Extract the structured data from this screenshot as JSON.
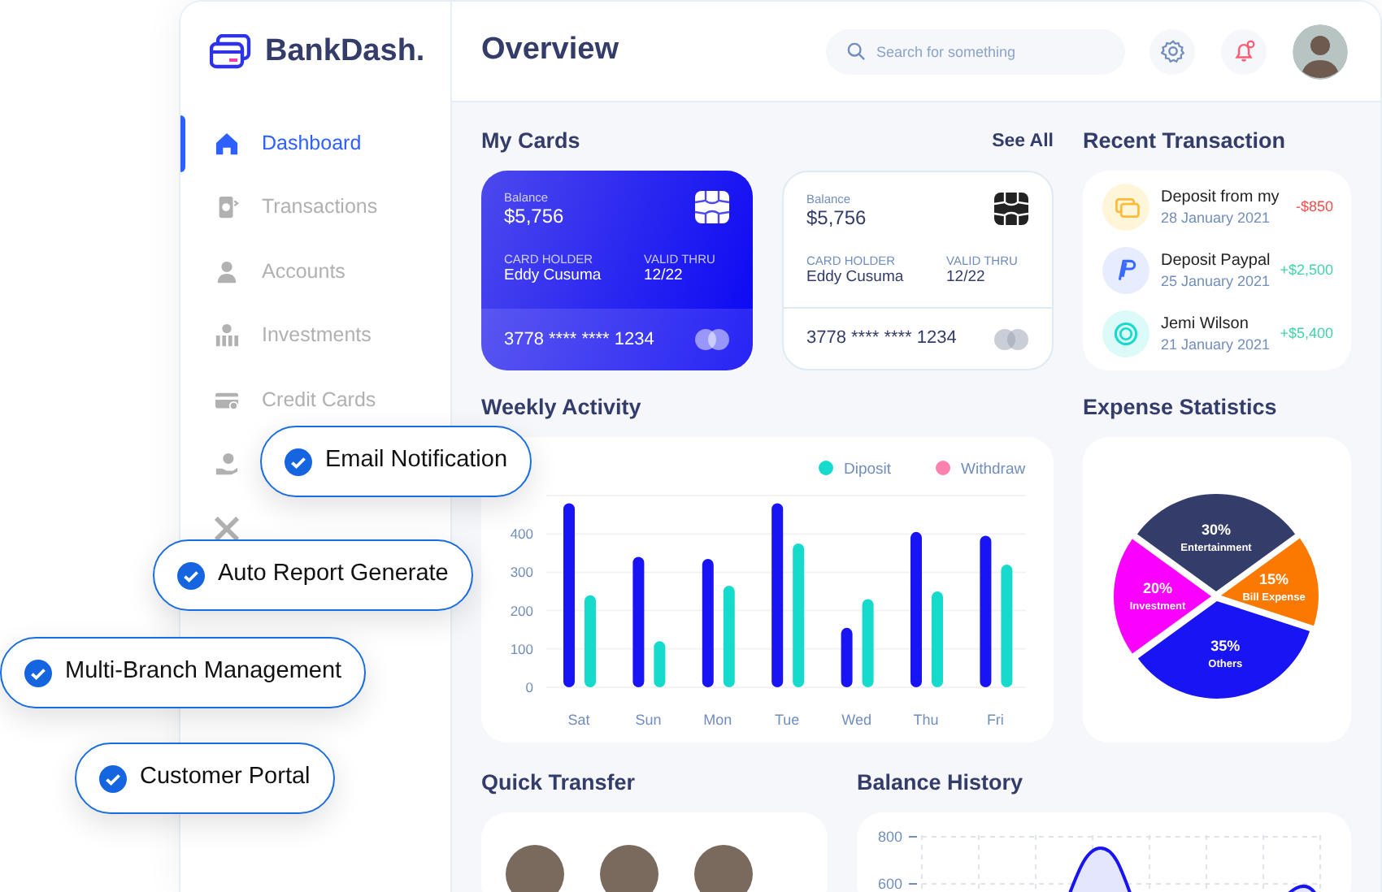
{
  "sidebar": {
    "logo": "BankDash.",
    "items": [
      {
        "label": "Dashboard",
        "selected": true
      },
      {
        "label": "Transactions",
        "selected": false
      },
      {
        "label": "Accounts",
        "selected": false
      },
      {
        "label": "Investments",
        "selected": false
      },
      {
        "label": "Credit Cards",
        "selected": false
      },
      {
        "selected": false
      },
      {
        "selected": false
      }
    ]
  },
  "header": {
    "title": "Overview",
    "search": {
      "placeholder": "Search for something"
    }
  },
  "my_cards": {
    "title": "My Cards",
    "link": "See All",
    "cards": [
      {
        "kind": "dark",
        "balance_label": "Balance",
        "balance": "$5,756",
        "holder_label": "CARD HOLDER",
        "holder": "Eddy Cusuma",
        "valid_label": "VALID THRU",
        "valid": "12/22",
        "number": "3778 **** **** 1234"
      },
      {
        "kind": "light",
        "balance_label": "Balance",
        "balance": "$5,756",
        "holder_label": "CARD HOLDER",
        "holder": "Eddy Cusuma",
        "valid_label": "VALID THRU",
        "valid": "12/22",
        "number": "3778 **** **** 1234"
      }
    ]
  },
  "recent_transactions": {
    "title": "Recent Transaction",
    "items": [
      {
        "kind": "card",
        "name": "Deposit from my",
        "date": "28 January 2021",
        "amount": "-$850",
        "color": "#ff4b4a"
      },
      {
        "kind": "paypal",
        "name": "Deposit Paypal",
        "date": "25 January 2021",
        "amount": "+$2,500",
        "color": "#41d4a8"
      },
      {
        "kind": "coin",
        "name": "Jemi Wilson",
        "date": "21 January 2021",
        "amount": "+$5,400",
        "color": "#41d4a8"
      }
    ]
  },
  "weekly_activity": {
    "title": "Weekly Activity",
    "legend": [
      {
        "label": "Diposit",
        "color": "#16dbcc"
      },
      {
        "label": "Withdraw",
        "color": "#ff82ac"
      }
    ],
    "chart_data": {
      "type": "bar",
      "categories": [
        "Sat",
        "Sun",
        "Mon",
        "Tue",
        "Wed",
        "Thu",
        "Fri"
      ],
      "series": [
        {
          "color": "#16dbcc",
          "values": [
            240,
            120,
            265,
            375,
            230,
            250,
            320
          ]
        },
        {
          "color": "#1814f3",
          "values": [
            480,
            340,
            335,
            480,
            155,
            405,
            395
          ]
        }
      ],
      "ylim": [
        0,
        500
      ],
      "yticks": [
        0,
        100,
        200,
        300,
        400
      ],
      "grid": true
    }
  },
  "expense_statistics": {
    "title": "Expense Statistics",
    "chart_data": {
      "type": "pie",
      "categories": [
        "Entertainment",
        "Bill Expense",
        "Others",
        "Investment"
      ],
      "series": [
        {
          "values": [
            30,
            15,
            35,
            20
          ]
        }
      ],
      "colors": [
        "#343c6a",
        "#fc7900",
        "#1814f3",
        "#fa00ff"
      ],
      "data_labels": "value_labels",
      "value_labels": [
        "30%",
        "15%",
        "35%",
        "20%"
      ]
    }
  },
  "quick_transfer": {
    "title": "Quick Transfer"
  },
  "balance_history": {
    "title": "Balance History",
    "y_labels": [
      "800",
      "600"
    ]
  },
  "features": [
    {
      "label": "Email Notification",
      "checked": true
    },
    {
      "label": "Auto Report Generate",
      "checked": true
    },
    {
      "label": "Multi-Branch Management",
      "checked": true
    },
    {
      "label": "Customer Portal",
      "checked": true
    }
  ]
}
